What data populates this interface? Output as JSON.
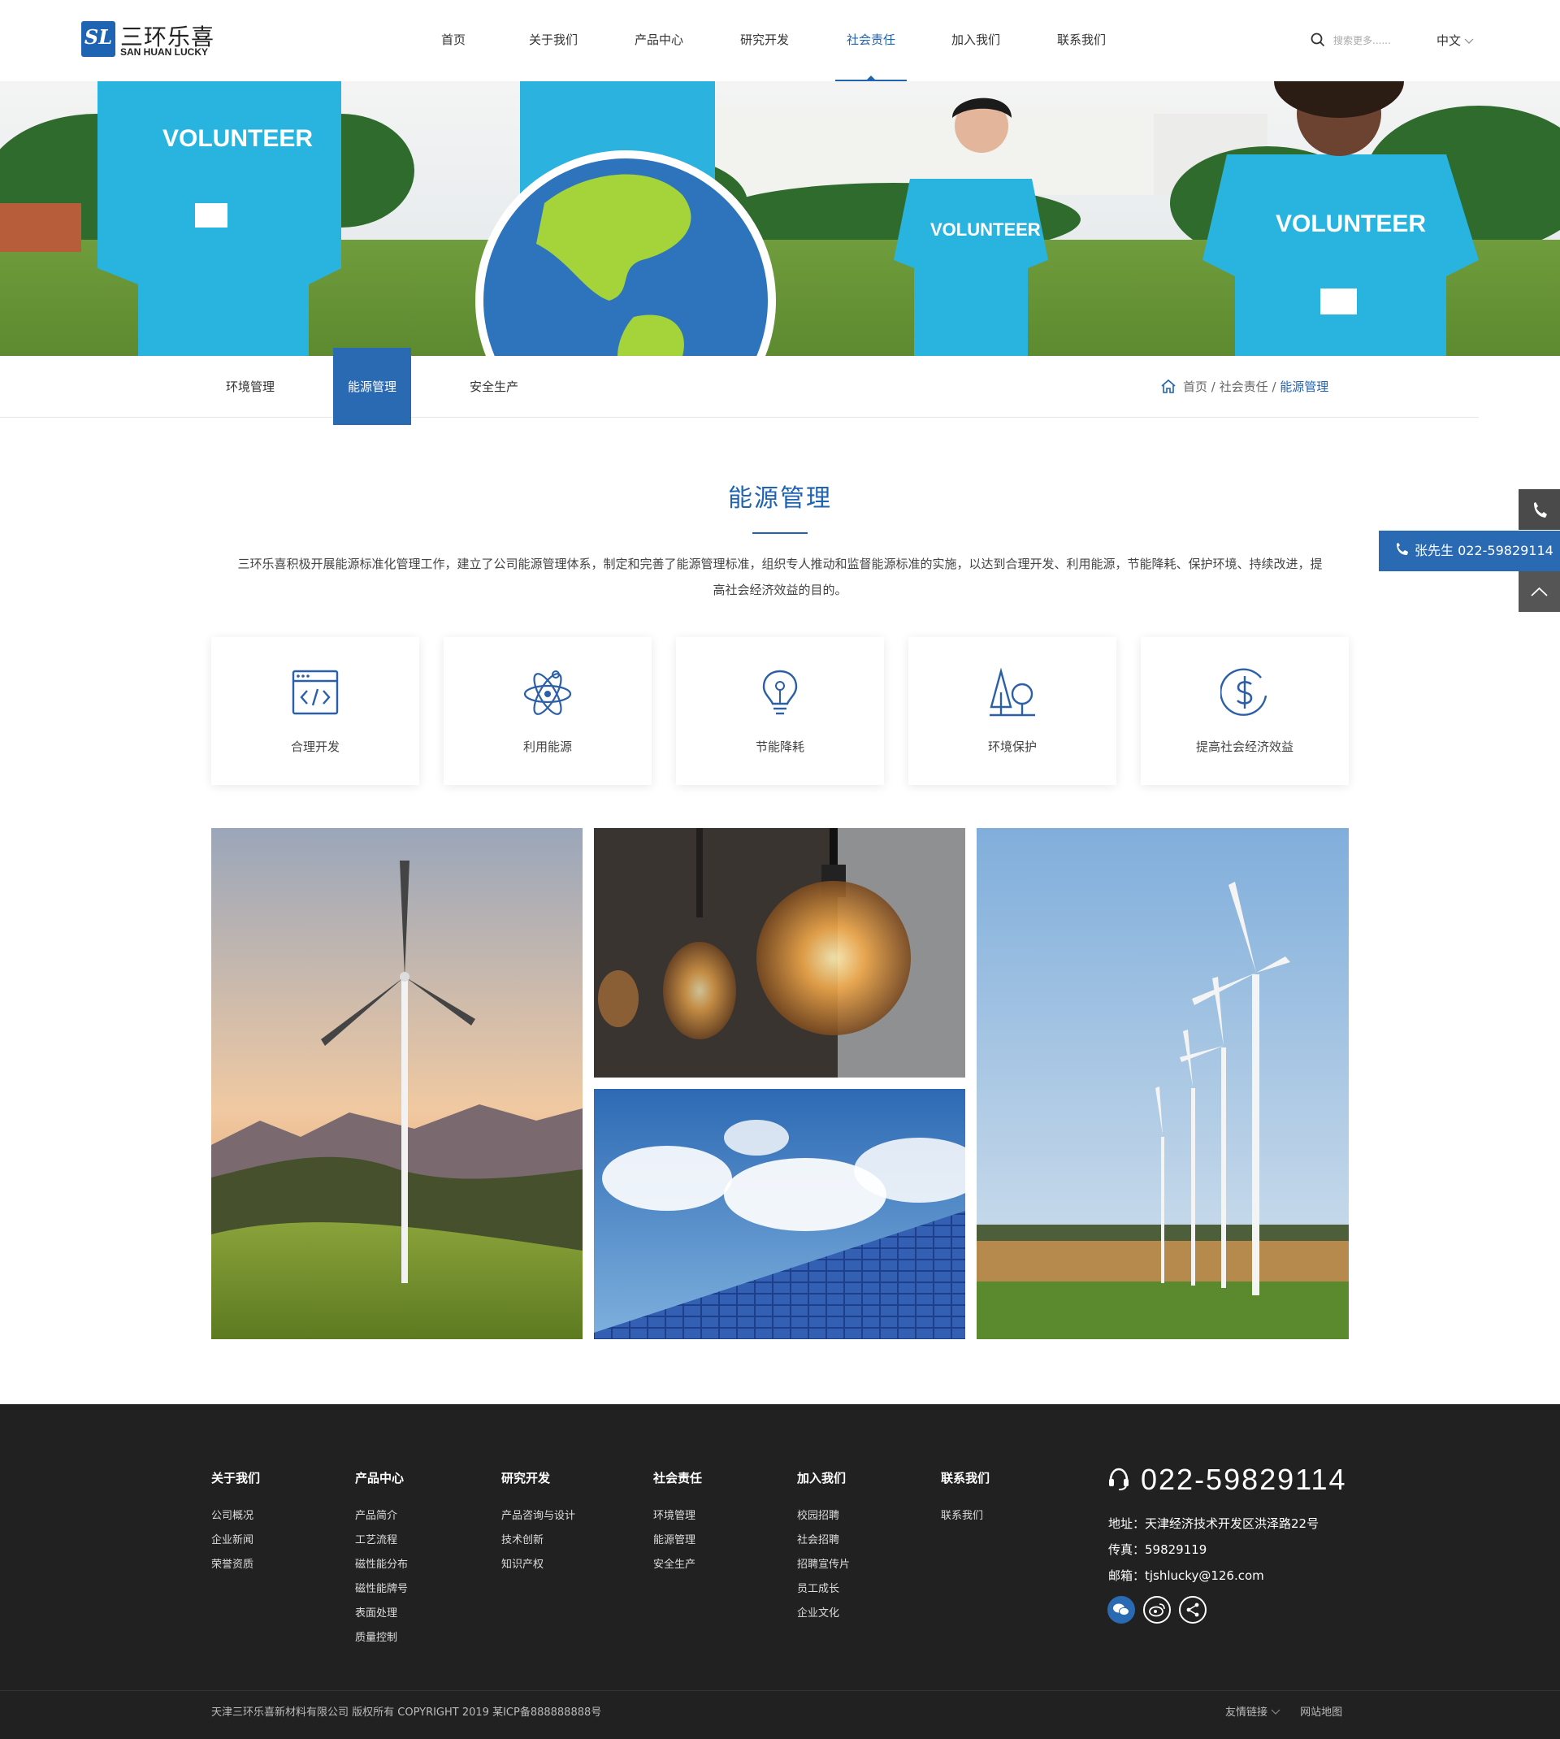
{
  "brand": {
    "mark": "SL",
    "name_cn": "三环乐喜",
    "name_en": "SAN HUAN LUCKY"
  },
  "nav": {
    "items": [
      "首页",
      "关于我们",
      "产品中心",
      "研究开发",
      "社会责任",
      "加入我们",
      "联系我们"
    ],
    "active": "社会责任"
  },
  "search": {
    "placeholder": "搜索更多......"
  },
  "language": "中文",
  "banner": {
    "shirt_text": "VOLUNTEER"
  },
  "subnav": {
    "tabs": [
      "环境管理",
      "能源管理",
      "安全生产"
    ],
    "active": "能源管理"
  },
  "breadcrumb": {
    "home": "首页",
    "sep1": "/",
    "section": "社会责任",
    "sep2": "/",
    "current": "能源管理"
  },
  "page": {
    "title": "能源管理",
    "intro": "三环乐喜积极开展能源标准化管理工作，建立了公司能源管理体系，制定和完善了能源管理标准，组织专人推动和监督能源标准的实施，以达到合理开发、利用能源，节能降耗、保护环境、持续改进，提高社会经济效益的目的。"
  },
  "cards": [
    {
      "label": "合理开发",
      "icon": "code-window-icon"
    },
    {
      "label": "利用能源",
      "icon": "atom-icon"
    },
    {
      "label": "节能降耗",
      "icon": "lightbulb-icon"
    },
    {
      "label": "环境保护",
      "icon": "trees-icon"
    },
    {
      "label": "提高社会经济效益",
      "icon": "dollar-circle-icon"
    }
  ],
  "float": {
    "tel": "张先生 022-59829114"
  },
  "footer": {
    "columns": [
      {
        "title": "关于我们",
        "links": [
          "公司概况",
          "企业新闻",
          "荣誉资质"
        ]
      },
      {
        "title": "产品中心",
        "links": [
          "产品简介",
          "工艺流程",
          "磁性能分布",
          "磁性能牌号",
          "表面处理",
          "质量控制"
        ]
      },
      {
        "title": "研究开发",
        "links": [
          "产品咨询与设计",
          "技术创新",
          "知识产权"
        ]
      },
      {
        "title": "社会责任",
        "links": [
          "环境管理",
          "能源管理",
          "安全生产"
        ]
      },
      {
        "title": "加入我们",
        "links": [
          "校园招聘",
          "社会招聘",
          "招聘宣传片",
          "员工成长",
          "企业文化"
        ]
      },
      {
        "title": "联系我们",
        "links": [
          "联系我们"
        ]
      }
    ],
    "phone": "022-59829114",
    "address": "地址：天津经济技术开发区洪泽路22号",
    "fax": "传真：59829119",
    "email": "邮箱：tjshlucky@126.com",
    "copyright": "天津三环乐喜新材料有限公司 版权所有 COPYRIGHT 2019  某ICP备888888888号",
    "links_label": "友情链接",
    "sitemap": "网站地图"
  },
  "colors": {
    "accent": "#1f63b3",
    "footer_bg": "#212121"
  }
}
